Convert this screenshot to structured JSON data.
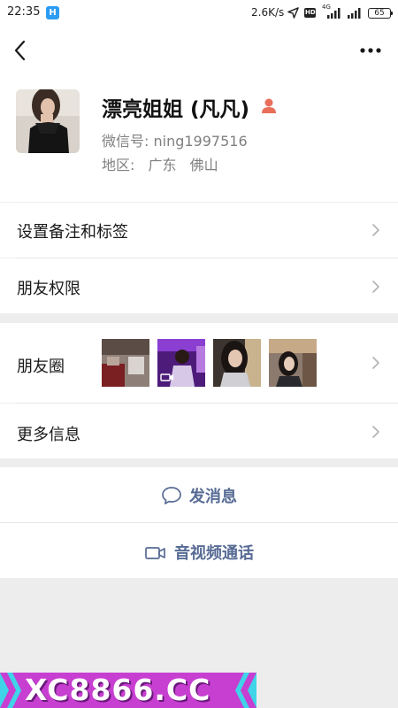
{
  "status_bar": {
    "time": "22:35",
    "app_icon_letter": "H",
    "net_speed": "2.6K/s",
    "hd": "HD",
    "network": "4G",
    "battery": "65"
  },
  "nav": {
    "back_icon": "chevron-left-icon",
    "more_icon": "more-dots-icon"
  },
  "profile": {
    "nickname": "漂亮姐姐 (凡凡)",
    "gender_icon": "female-icon",
    "wechat_id": "微信号: ning1997516",
    "region_label": "地区:",
    "region_province": "广东",
    "region_city": "佛山"
  },
  "menu": {
    "remark": "设置备注和标签",
    "permissions": "朋友权限",
    "moments": "朋友圈",
    "more_info": "更多信息"
  },
  "actions": {
    "message": "发消息",
    "video_call": "音视频通话"
  },
  "banner": {
    "text": "XC8866.CC"
  },
  "colors": {
    "link_blue": "#576b95",
    "background": "#ededed",
    "banner": "#c73fd1"
  }
}
